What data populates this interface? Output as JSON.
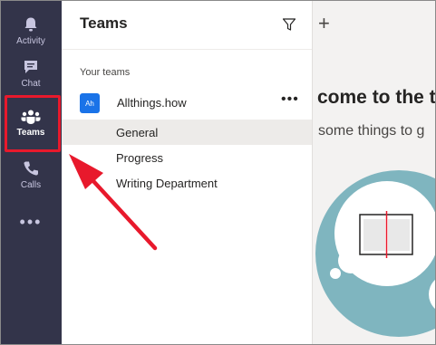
{
  "rail": {
    "items": [
      {
        "label": "Activity",
        "icon": "bell-icon"
      },
      {
        "label": "Chat",
        "icon": "chat-icon"
      },
      {
        "label": "Teams",
        "icon": "teams-icon"
      },
      {
        "label": "Calls",
        "icon": "phone-icon"
      }
    ],
    "more_label": "•••"
  },
  "panel": {
    "title": "Teams",
    "section_label": "Your teams",
    "team": {
      "avatar": "Ah",
      "name": "Allthings.how",
      "more": "•••"
    },
    "channels": [
      {
        "label": "General",
        "selected": true
      },
      {
        "label": "Progress",
        "selected": false
      },
      {
        "label": "Writing Department",
        "selected": false
      }
    ]
  },
  "content": {
    "add_label": "+",
    "welcome_text": "come to the t",
    "subtitle_text": "some things to g"
  },
  "colors": {
    "rail_bg": "#33344a",
    "highlight": "#e8192c",
    "avatar": "#1a73e8",
    "illustration": "#7fb5bf"
  }
}
